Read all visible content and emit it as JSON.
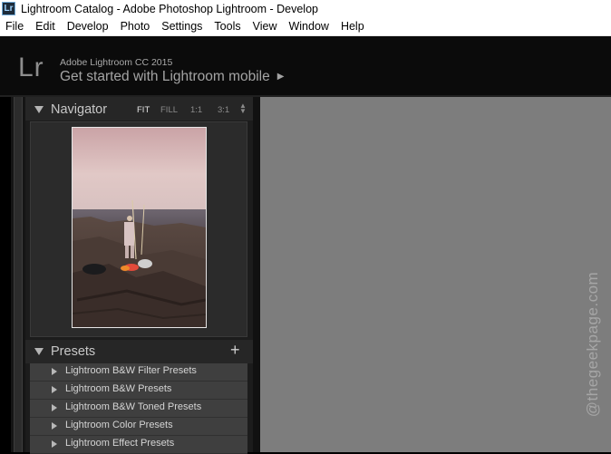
{
  "window": {
    "icon": "Lr",
    "title": "Lightroom Catalog - Adobe Photoshop Lightroom - Develop"
  },
  "menu": [
    "File",
    "Edit",
    "Develop",
    "Photo",
    "Settings",
    "Tools",
    "View",
    "Window",
    "Help"
  ],
  "identity": {
    "logo": "Lr",
    "version": "Adobe Lightroom CC 2015",
    "mobile_prompt": "Get started with Lightroom mobile",
    "arrow": "▶"
  },
  "navigator": {
    "title": "Navigator",
    "zoom_options": [
      "FIT",
      "FILL",
      "1:1",
      "3:1"
    ],
    "active_zoom": "FIT",
    "stepper": "⬍"
  },
  "presets": {
    "title": "Presets",
    "add_label": "+",
    "items": [
      "Lightroom B&W Filter Presets",
      "Lightroom B&W Presets",
      "Lightroom B&W Toned Presets",
      "Lightroom Color Presets",
      "Lightroom Effect Presets"
    ]
  },
  "watermark": "@thegeekpage.com",
  "colors": {
    "panel_bg": "#1c1c1c",
    "canvas_bg": "#7d7d7d",
    "header_bg": "#262626",
    "text_light": "#c8c8c8"
  },
  "icons": {
    "collapse": "triangle-down-icon",
    "expand": "triangle-right-icon",
    "add": "plus-icon",
    "stepper": "updown-icon"
  }
}
